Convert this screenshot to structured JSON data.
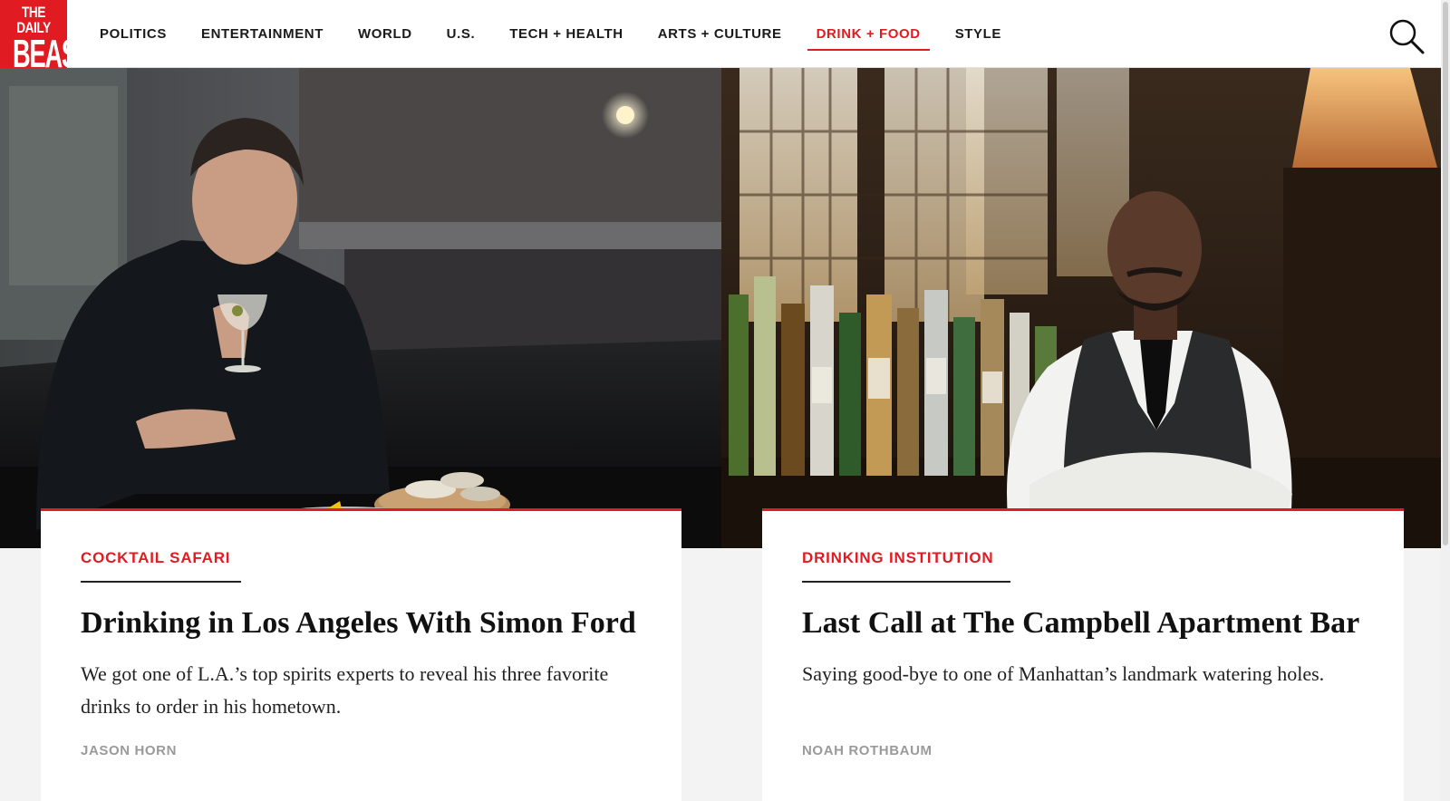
{
  "logo": {
    "line1": "THE DAILY",
    "line2": "BEAST"
  },
  "nav": {
    "items": [
      {
        "label": "POLITICS"
      },
      {
        "label": "ENTERTAINMENT"
      },
      {
        "label": "WORLD"
      },
      {
        "label": "U.S."
      },
      {
        "label": "TECH + HEALTH"
      },
      {
        "label": "ARTS + CULTURE"
      },
      {
        "label": "DRINK + FOOD",
        "active": true
      },
      {
        "label": "STYLE"
      }
    ],
    "search_icon": "search-icon"
  },
  "colors": {
    "accent": "#e01b22",
    "byline": "#9a9a9a",
    "text": "#111111"
  },
  "articles": [
    {
      "kicker": "COCKTAIL SAFARI",
      "headline": "Drinking in Los Angeles With Simon Ford",
      "dek": "We got one of L.A.’s top spirits experts to reveal his three favorite drinks to order in his hometown.",
      "byline": "JASON HORN"
    },
    {
      "kicker": "DRINKING INSTITUTION",
      "headline": "Last Call at The Campbell Apartment Bar",
      "dek": "Saying good-bye to one of Manhattan’s landmark watering holes.",
      "byline": "NOAH ROTHBAUM"
    }
  ]
}
